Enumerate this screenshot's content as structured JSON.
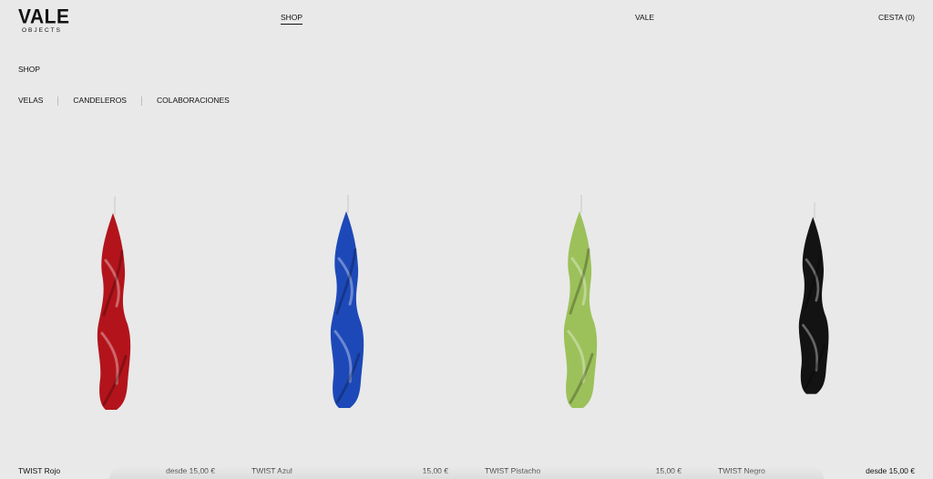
{
  "header": {
    "logo": {
      "main": "VALE",
      "sub": "OBJECTS"
    },
    "nav": {
      "shop": "SHOP",
      "vale": "VALE",
      "cart": "CESTA (0)"
    }
  },
  "section_title": "SHOP",
  "categories": [
    "VELAS",
    "CANDELEROS",
    "COLABORACIONES"
  ],
  "products": [
    {
      "name": "TWIST Rojo",
      "price": "desde 15,00 €",
      "color": "#b3141b"
    },
    {
      "name": "TWIST Azul",
      "price": "15,00 €",
      "color": "#1d49b8"
    },
    {
      "name": "TWIST Pistacho",
      "price": "15,00 €",
      "color": "#9cc15a"
    },
    {
      "name": "TWIST Negro",
      "price": "desde 15,00 €",
      "color": "#131313"
    }
  ]
}
